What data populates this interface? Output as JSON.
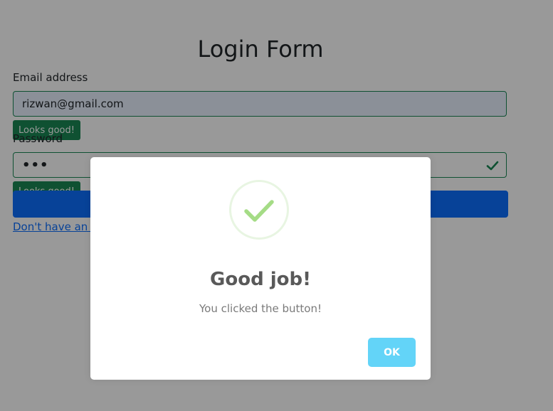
{
  "login_form": {
    "title": "Login Form",
    "email_label": "Email address",
    "email_value": "rizwan@gmail.com",
    "password_label": "Password",
    "password_value": "•••",
    "valid_feedback": "Looks good!",
    "register_link": "Don't have an account? Register"
  },
  "modal": {
    "icon": "checkmark-success-icon",
    "title": "Good job!",
    "text": "You clicked the button!",
    "ok_label": "OK"
  },
  "colors": {
    "valid_green": "#198754",
    "primary_blue": "#0d6efd",
    "ok_button": "#63d4f8",
    "success_check": "#a5dc86"
  }
}
